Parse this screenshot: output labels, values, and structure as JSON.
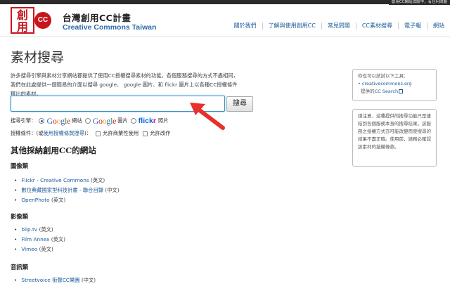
{
  "top_notice": "創用CC網站改版中，有任何問題",
  "header": {
    "logo_text": "創用",
    "logo_cc": "CC",
    "title": "台灣創用CC計畫",
    "subtitle": "Creative Commons Taiwan"
  },
  "nav": [
    "關於我們",
    "了解與使用創用CC",
    "常見問題",
    "CC素材搜尋",
    "電子報",
    "網站"
  ],
  "page_title": "素材搜尋",
  "intro": "許多搜尋引擎與素材分享網站都提供了使用CC授權搜尋素材的功能。各個服務搜尋的方式不盡相同，我們在此處提供一個簡易的介面以搜尋 google、 google 圖片、和 flickr 圖片上以各種CC授權條件釋出的素材。",
  "search": {
    "value": "",
    "placeholder": "",
    "button_label": "搜尋"
  },
  "engine": {
    "label": "搜尋引擎：",
    "options": [
      {
        "logo": "Google",
        "label": "網站",
        "selected": true
      },
      {
        "logo": "Google",
        "label": "圖片",
        "selected": false
      },
      {
        "logo": "flickr",
        "label": "照片",
        "selected": false
      }
    ]
  },
  "conditions": {
    "label_prefix": "授權條件：(或 ",
    "link": "使用授權條款搜尋",
    "label_suffix": ")：",
    "options": [
      {
        "label": "允許商業性使用",
        "checked": false
      },
      {
        "label": "允許改作",
        "checked": false
      }
    ]
  },
  "other_sites": {
    "title": "其他採納創用CC的網站",
    "categories": [
      {
        "name": "圖像類",
        "items": [
          {
            "name": "Flickr - Creative Commons",
            "lang": "(英文)"
          },
          {
            "name": "數位典藏國家型科技計畫 - 聯合目錄",
            "lang": "(中文)"
          },
          {
            "name": "OpenPhoto",
            "lang": "(英文)"
          }
        ]
      },
      {
        "name": "影像類",
        "items": [
          {
            "name": "blip.tv",
            "lang": "(英文)"
          },
          {
            "name": "Film Annex",
            "lang": "(英文)"
          },
          {
            "name": "Vimeo",
            "lang": "(英文)"
          }
        ]
      },
      {
        "name": "音訊類",
        "items": [
          {
            "name": "Streetvoice 街聲CC樂園",
            "lang": "(中文)"
          }
        ]
      }
    ]
  },
  "sidebar": {
    "tool_text": "你也可以試試以下工具：",
    "tool_site": "creativecommons.org",
    "tool_provided": "提供的",
    "tool_link": "CC Search",
    "warning": "請注意，這種提供的搜尋功能只是連結到各個服務本身的搜尋結果，該服務之授權方式亦可能改變而使搜尋的結果不盡正確。使用前，請務必確認該素材的授權條款。"
  },
  "colors": {
    "brand_red": "#c8161d",
    "link_blue": "#1a5a9a",
    "arrow_red": "#e8302a"
  }
}
